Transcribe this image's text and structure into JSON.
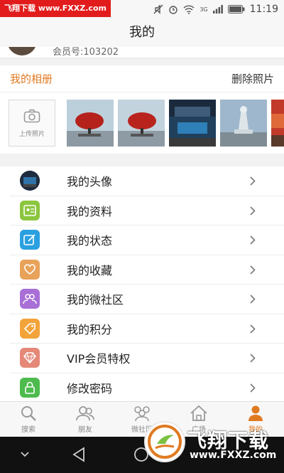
{
  "watermark": {
    "top": "飞翔下载 www.FXXZ.com",
    "text": "飞翔下载",
    "url": "www.FXXZ.com"
  },
  "status_bar": {
    "network": "3G",
    "time": "11:19"
  },
  "header": {
    "title": "我的"
  },
  "profile": {
    "member_no": "会员号:103202"
  },
  "album": {
    "title": "我的相册",
    "delete_label": "删除照片",
    "upload_label": "上传照片"
  },
  "menu": {
    "items": [
      {
        "label": "我的头像",
        "color": "#2b3a4f"
      },
      {
        "label": "我的资料",
        "color": "#8cc63f"
      },
      {
        "label": "我的状态",
        "color": "#2aa0e0"
      },
      {
        "label": "我的收藏",
        "color": "#e8a25a"
      },
      {
        "label": "我的微社区",
        "color": "#a86fd6"
      },
      {
        "label": "我的积分",
        "color": "#f2a33a"
      },
      {
        "label": "VIP会员特权",
        "color": "#e58878"
      },
      {
        "label": "修改密码",
        "color": "#4dbb4d"
      }
    ]
  },
  "bottom_nav": {
    "items": [
      {
        "label": "搜索"
      },
      {
        "label": "朋友"
      },
      {
        "label": "微社区"
      },
      {
        "label": "广场"
      },
      {
        "label": "我的"
      }
    ],
    "active_color": "#e07a22"
  }
}
